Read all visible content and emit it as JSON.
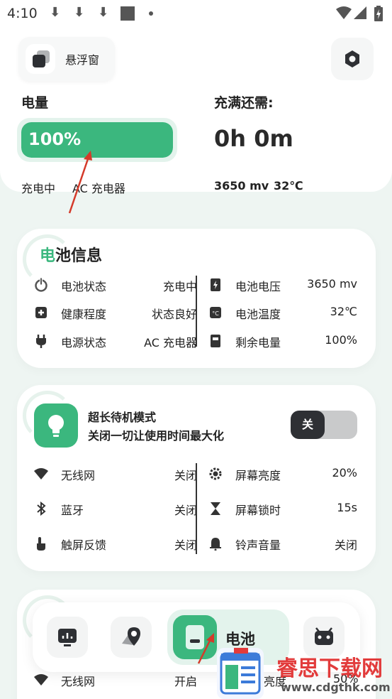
{
  "status_bar": {
    "time": "4:10",
    "dl_icon": "⬇"
  },
  "header": {
    "float_label": "悬浮窗"
  },
  "battery_top": {
    "level_label": "电量",
    "level_text": "100%",
    "level_fraction": 1.0,
    "full_label": "充满还需:",
    "full_time": "0h 0m",
    "charge_state": "充电中",
    "charger": "AC 充电器",
    "voltage": "3650 mv",
    "temp": "32℃"
  },
  "battery_info": {
    "title_first": "电",
    "title_rest": "池信息",
    "left": [
      {
        "icon": "power-icon",
        "label": "电池状态",
        "value": "充电中"
      },
      {
        "icon": "health-icon",
        "label": "健康程度",
        "value": "状态良好"
      },
      {
        "icon": "plug-icon",
        "label": "电源状态",
        "value": "AC 充电器"
      }
    ],
    "right": [
      {
        "icon": "voltage-icon",
        "label": "电池电压",
        "value": "3650 mv"
      },
      {
        "icon": "temperature-icon",
        "label": "电池温度",
        "value": "32℃"
      },
      {
        "icon": "battery-remaining-icon",
        "label": "剩余电量",
        "value": "100%"
      }
    ]
  },
  "standby": {
    "title": "超长待机模式",
    "desc": "关闭一切让使用时间最大化",
    "toggle_label": "关",
    "left": [
      {
        "icon": "wifi-icon",
        "label": "无线网",
        "value": "关闭"
      },
      {
        "icon": "bluetooth-icon",
        "label": "蓝牙",
        "value": "关闭"
      },
      {
        "icon": "touch-icon",
        "label": "触屏反馈",
        "value": "关闭"
      }
    ],
    "right": [
      {
        "icon": "brightness-icon",
        "label": "屏幕亮度",
        "value": "20%"
      },
      {
        "icon": "hourglass-icon",
        "label": "屏幕锁时",
        "value": "15s"
      },
      {
        "icon": "bell-icon",
        "label": "铃声音量",
        "value": "关闭"
      }
    ]
  },
  "partial": {
    "wifi_label": "无线网",
    "wifi_value": "开启",
    "right_label_fragment": "亮度",
    "right_value": "50%"
  },
  "nav": {
    "active_label": "电池"
  },
  "watermark": {
    "name": "睿思下载网",
    "url": "www.cdgthk.com"
  },
  "colors": {
    "accent": "#3bb77e",
    "dark": "#2e3034",
    "bg": "#eef5f2"
  }
}
